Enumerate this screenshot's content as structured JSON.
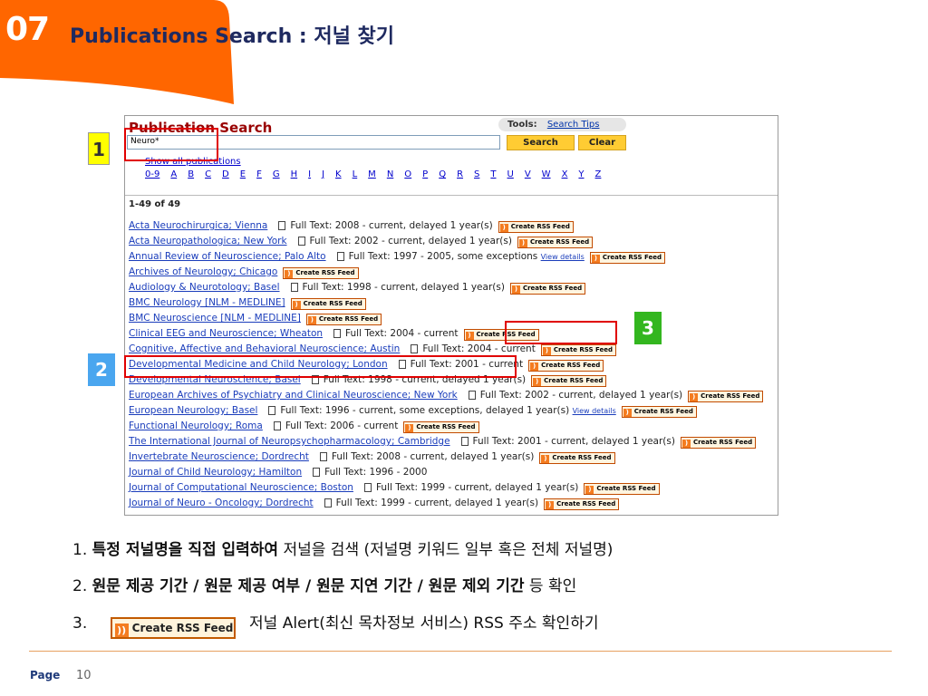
{
  "header": {
    "slide_number": "07",
    "title": "Publications Search : 저널 찾기"
  },
  "colors": {
    "accent_orange": "#ff6600",
    "title_navy": "#1f2a60",
    "callout_red": "#e00000"
  },
  "screenshot": {
    "heading": "Publication Search",
    "tools_label": "Tools:",
    "search_tips": "Search Tips",
    "search_value": "Neuro*",
    "search_button": "Search",
    "clear_button": "Clear",
    "show_all": "Show all publications",
    "alphabet": [
      "0-9",
      "A",
      "B",
      "C",
      "D",
      "E",
      "F",
      "G",
      "H",
      "I",
      "J",
      "K",
      "L",
      "M",
      "N",
      "O",
      "P",
      "Q",
      "R",
      "S",
      "T",
      "U",
      "V",
      "W",
      "X",
      "Y",
      "Z"
    ],
    "result_count": "1-49 of 49",
    "rss_label": "Create RSS Feed",
    "view_details": "View details",
    "results": [
      {
        "title": "Acta Neurochirurgica; Vienna",
        "fulltext": "Full Text: 2008 - current, delayed 1 year(s)",
        "details": false
      },
      {
        "title": "Acta Neuropathologica; New York",
        "fulltext": "Full Text: 2002 - current, delayed 1 year(s)",
        "details": false
      },
      {
        "title": "Annual Review of Neuroscience; Palo Alto",
        "fulltext": "Full Text: 1997 - 2005, some exceptions",
        "details": true
      },
      {
        "title": "Archives of Neurology; Chicago",
        "fulltext": "",
        "details": false
      },
      {
        "title": "Audiology & Neurotology; Basel",
        "fulltext": "Full Text: 1998 - current, delayed 1 year(s)",
        "details": false
      },
      {
        "title": "BMC Neurology [NLM - MEDLINE]",
        "fulltext": "",
        "details": false
      },
      {
        "title": "BMC Neuroscience [NLM - MEDLINE]",
        "fulltext": "",
        "details": false
      },
      {
        "title": "Clinical EEG and Neuroscience; Wheaton",
        "fulltext": "Full Text: 2004 - current",
        "details": false
      },
      {
        "title": "Cognitive, Affective and Behavioral Neuroscience; Austin",
        "fulltext": "Full Text: 2004 - current",
        "details": false
      },
      {
        "title": "Developmental Medicine and Child Neurology; London",
        "fulltext": "Full Text: 2001 - current",
        "details": false
      },
      {
        "title": "Developmental Neuroscience; Basel",
        "fulltext": "Full Text: 1998 - current, delayed 1 year(s)",
        "details": false
      },
      {
        "title": "European Archives of Psychiatry and Clinical Neuroscience; New York",
        "fulltext": "Full Text: 2002 - current, delayed 1 year(s)",
        "details": false
      },
      {
        "title": "European Neurology; Basel",
        "fulltext": "Full Text: 1996 - current, some exceptions, delayed 1 year(s)",
        "details": true
      },
      {
        "title": "Functional Neurology; Roma",
        "fulltext": "Full Text: 2006 - current",
        "details": false
      },
      {
        "title": "The International Journal of Neuropsychopharmacology; Cambridge",
        "fulltext": "Full Text: 2001 - current, delayed 1 year(s)",
        "details": false
      },
      {
        "title": "Invertebrate Neuroscience; Dordrecht",
        "fulltext": "Full Text: 2008 - current, delayed 1 year(s)",
        "details": false
      },
      {
        "title": "Journal of Child Neurology; Hamilton",
        "fulltext": "Full Text: 1996 - 2000",
        "details": false,
        "norss": true
      },
      {
        "title": "Journal of Computational Neuroscience; Boston",
        "fulltext": "Full Text: 1999 - current, delayed 1 year(s)",
        "details": false
      },
      {
        "title": "Journal of Neuro - Oncology; Dordrecht",
        "fulltext": "Full Text: 1999 - current, delayed 1 year(s)",
        "details": false
      }
    ]
  },
  "badges": {
    "b1": "1",
    "b2": "2",
    "b3": "3"
  },
  "notes": {
    "n1_num": "1.",
    "n1_bold": "특정 저널명을 직접 입력하여",
    "n1_rest": " 저널을 검색 (저널명 키워드 일부 혹은 전체 저널명)",
    "n2_num": "2.",
    "n2_bold": "원문 제공 기간 / 원문 제공 여부 / 원문 지연 기간 / 원문 제외 기간",
    "n2_rest": " 등 확인",
    "n3_num": "3.",
    "n3_rss": "Create RSS Feed",
    "n3_rest": "저널 Alert(최신 목차정보 서비스) RSS 주소 확인하기"
  },
  "footer": {
    "page_label": "Page",
    "page_number": "10"
  }
}
